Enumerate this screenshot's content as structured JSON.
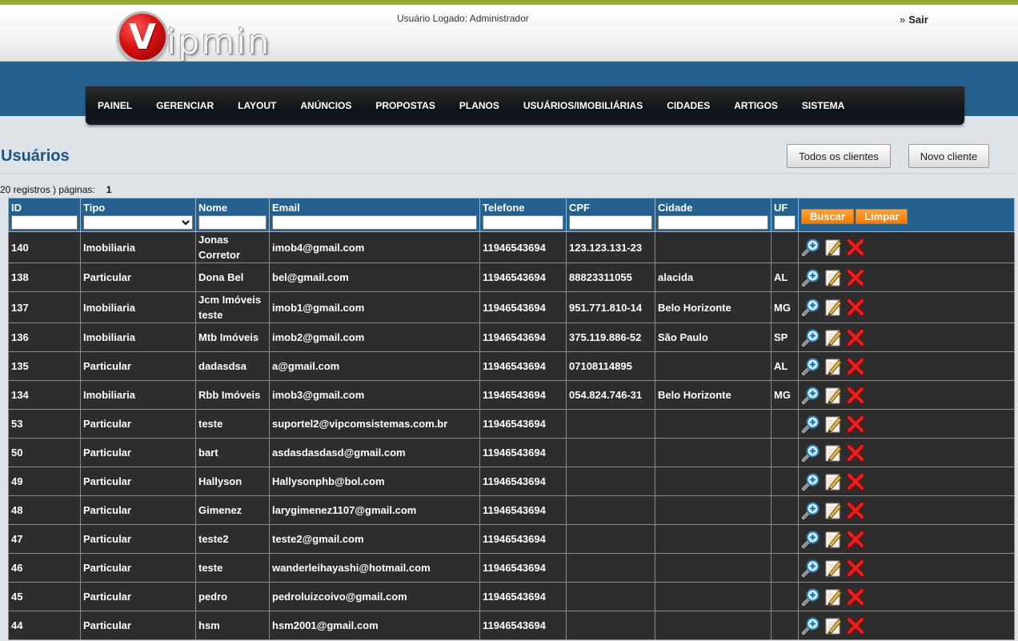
{
  "header": {
    "logo_letter": "V",
    "logo_rest": "ipmin",
    "logged_user": "Usuário Logado: Administrador",
    "logout_arrow": "»",
    "logout_label": "Sair"
  },
  "nav": {
    "items": [
      "PAINEL",
      "GERENCIAR",
      "LAYOUT",
      "ANÚNCIOS",
      "PROPOSTAS",
      "PLANOS",
      "USUÁRIOS/IMOBILIÁRIAS",
      "CIDADES",
      "ARTIGOS",
      "SISTEMA"
    ]
  },
  "page": {
    "title": "Usuários",
    "btn_all_clients": "Todos os clientes",
    "btn_new_client": "Novo cliente",
    "records_text": "20 registros ) páginas:",
    "page_number": "1"
  },
  "table": {
    "headers": [
      "ID",
      "Tipo",
      "Nome",
      "Email",
      "Telefone",
      "CPF",
      "Cidade",
      "UF"
    ],
    "search_label": "Buscar",
    "clear_label": "Limpar",
    "icons": [
      "view-icon",
      "edit-icon",
      "delete-icon"
    ],
    "rows": [
      [
        "140",
        "Imobiliaria",
        "Jonas Corretor",
        "imob4@gmail.com",
        "11946543694",
        "123.123.131-23",
        "",
        ""
      ],
      [
        "138",
        "Particular",
        "Dona Bel",
        "bel@gmail.com",
        "11946543694",
        "88823311055",
        "alacida",
        "AL"
      ],
      [
        "137",
        "Imobiliaria",
        "Jcm Imóveis teste",
        "imob1@gmail.com",
        "11946543694",
        "951.771.810-14",
        "Belo Horizonte",
        "MG"
      ],
      [
        "136",
        "Imobiliaria",
        "Mtb Imóveis",
        "imob2@gmail.com",
        "11946543694",
        "375.119.886-52",
        "São Paulo",
        "SP"
      ],
      [
        "135",
        "Particular",
        "dadasdsa",
        "a@gmail.com",
        "11946543694",
        "07108114895",
        "",
        "AL"
      ],
      [
        "134",
        "Imobiliaria",
        "Rbb Imóveis",
        "imob3@gmail.com",
        "11946543694",
        "054.824.746-31",
        "Belo Horizonte",
        "MG"
      ],
      [
        "53",
        "Particular",
        "teste",
        "suportel2@vipcomsistemas.com.br",
        "11946543694",
        "",
        "",
        ""
      ],
      [
        "50",
        "Particular",
        "bart",
        "asdasdasdasd@gmail.com",
        "11946543694",
        "",
        "",
        ""
      ],
      [
        "49",
        "Particular",
        "Hallyson",
        "Hallysonphb@bol.com",
        "11946543694",
        "",
        "",
        ""
      ],
      [
        "48",
        "Particular",
        "Gimenez",
        "larygimenez1107@gmail.com",
        "11946543694",
        "",
        "",
        ""
      ],
      [
        "47",
        "Particular",
        "teste2",
        "teste2@gmail.com",
        "11946543694",
        "",
        "",
        ""
      ],
      [
        "46",
        "Particular",
        "teste",
        "wanderleihayashi@hotmail.com",
        "11946543694",
        "",
        "",
        ""
      ],
      [
        "45",
        "Particular",
        "pedro",
        "pedroluizcoivo@gmail.com",
        "11946543694",
        "",
        "",
        ""
      ],
      [
        "44",
        "Particular",
        "hsm",
        "hsm2001@gmail.com",
        "11946543694",
        "",
        "",
        ""
      ]
    ]
  },
  "colors": {
    "nav_band": "#24618f",
    "title": "#1a5585",
    "accent_orange": "#f28a12",
    "row_bg": "#2d2d2d"
  }
}
